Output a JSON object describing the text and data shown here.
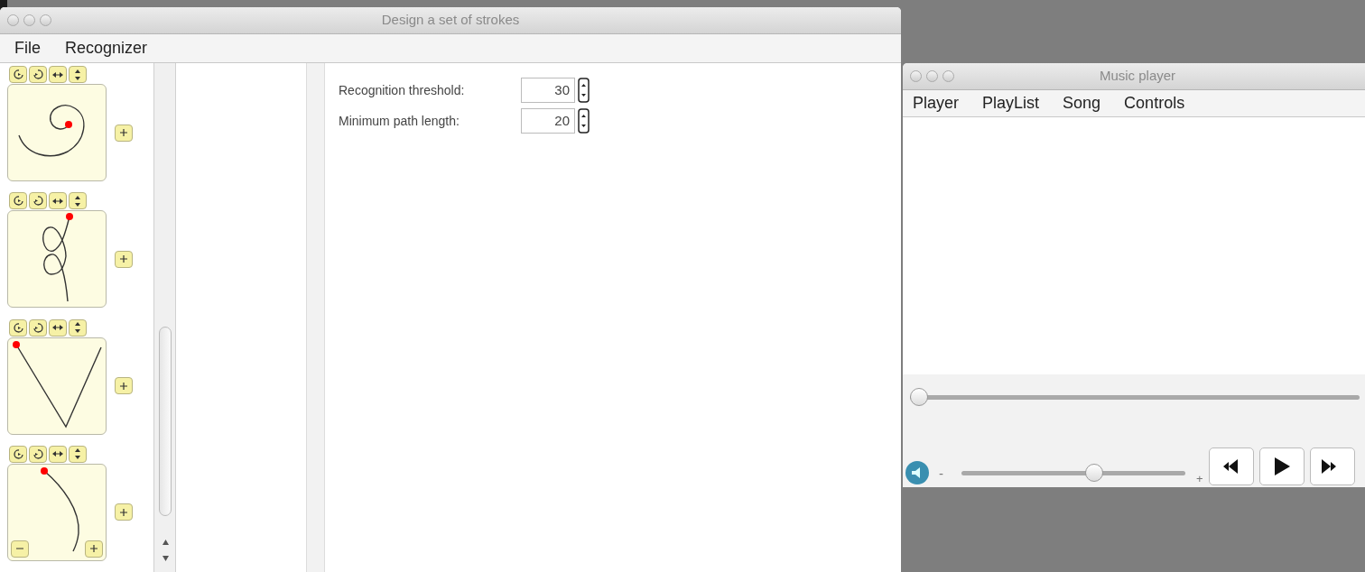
{
  "stroke_window": {
    "title": "Design a set of strokes",
    "menu": [
      "File",
      "Recognizer"
    ],
    "strokes": [
      {
        "kind": "spiral"
      },
      {
        "kind": "loops"
      },
      {
        "kind": "vee"
      },
      {
        "kind": "arc"
      }
    ],
    "settings": [
      {
        "label": "Recognition threshold:",
        "value": "30"
      },
      {
        "label": "Minimum path length:",
        "value": "20"
      }
    ]
  },
  "music_player": {
    "title": "Music player",
    "menu": [
      "Player",
      "PlayList",
      "Song",
      "Controls"
    ],
    "position": {
      "level": 0
    },
    "volume": {
      "minus": "-",
      "plus": "+",
      "level": 0.6
    }
  }
}
